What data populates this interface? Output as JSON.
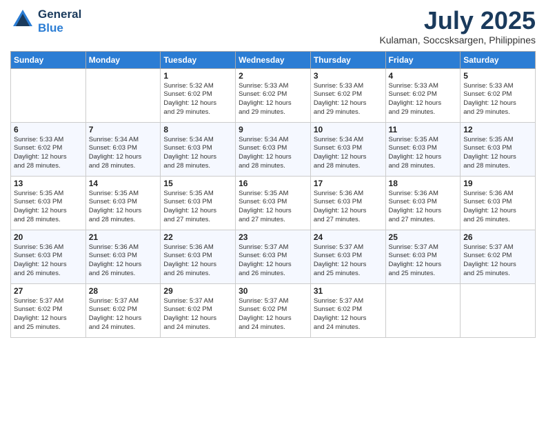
{
  "header": {
    "logo_line1": "General",
    "logo_line2": "Blue",
    "month": "July 2025",
    "location": "Kulaman, Soccsksargen, Philippines"
  },
  "days_of_week": [
    "Sunday",
    "Monday",
    "Tuesday",
    "Wednesday",
    "Thursday",
    "Friday",
    "Saturday"
  ],
  "weeks": [
    [
      {
        "day": "",
        "info": ""
      },
      {
        "day": "",
        "info": ""
      },
      {
        "day": "1",
        "info": "Sunrise: 5:32 AM\nSunset: 6:02 PM\nDaylight: 12 hours\nand 29 minutes."
      },
      {
        "day": "2",
        "info": "Sunrise: 5:33 AM\nSunset: 6:02 PM\nDaylight: 12 hours\nand 29 minutes."
      },
      {
        "day": "3",
        "info": "Sunrise: 5:33 AM\nSunset: 6:02 PM\nDaylight: 12 hours\nand 29 minutes."
      },
      {
        "day": "4",
        "info": "Sunrise: 5:33 AM\nSunset: 6:02 PM\nDaylight: 12 hours\nand 29 minutes."
      },
      {
        "day": "5",
        "info": "Sunrise: 5:33 AM\nSunset: 6:02 PM\nDaylight: 12 hours\nand 29 minutes."
      }
    ],
    [
      {
        "day": "6",
        "info": "Sunrise: 5:33 AM\nSunset: 6:02 PM\nDaylight: 12 hours\nand 28 minutes."
      },
      {
        "day": "7",
        "info": "Sunrise: 5:34 AM\nSunset: 6:03 PM\nDaylight: 12 hours\nand 28 minutes."
      },
      {
        "day": "8",
        "info": "Sunrise: 5:34 AM\nSunset: 6:03 PM\nDaylight: 12 hours\nand 28 minutes."
      },
      {
        "day": "9",
        "info": "Sunrise: 5:34 AM\nSunset: 6:03 PM\nDaylight: 12 hours\nand 28 minutes."
      },
      {
        "day": "10",
        "info": "Sunrise: 5:34 AM\nSunset: 6:03 PM\nDaylight: 12 hours\nand 28 minutes."
      },
      {
        "day": "11",
        "info": "Sunrise: 5:35 AM\nSunset: 6:03 PM\nDaylight: 12 hours\nand 28 minutes."
      },
      {
        "day": "12",
        "info": "Sunrise: 5:35 AM\nSunset: 6:03 PM\nDaylight: 12 hours\nand 28 minutes."
      }
    ],
    [
      {
        "day": "13",
        "info": "Sunrise: 5:35 AM\nSunset: 6:03 PM\nDaylight: 12 hours\nand 28 minutes."
      },
      {
        "day": "14",
        "info": "Sunrise: 5:35 AM\nSunset: 6:03 PM\nDaylight: 12 hours\nand 28 minutes."
      },
      {
        "day": "15",
        "info": "Sunrise: 5:35 AM\nSunset: 6:03 PM\nDaylight: 12 hours\nand 27 minutes."
      },
      {
        "day": "16",
        "info": "Sunrise: 5:35 AM\nSunset: 6:03 PM\nDaylight: 12 hours\nand 27 minutes."
      },
      {
        "day": "17",
        "info": "Sunrise: 5:36 AM\nSunset: 6:03 PM\nDaylight: 12 hours\nand 27 minutes."
      },
      {
        "day": "18",
        "info": "Sunrise: 5:36 AM\nSunset: 6:03 PM\nDaylight: 12 hours\nand 27 minutes."
      },
      {
        "day": "19",
        "info": "Sunrise: 5:36 AM\nSunset: 6:03 PM\nDaylight: 12 hours\nand 26 minutes."
      }
    ],
    [
      {
        "day": "20",
        "info": "Sunrise: 5:36 AM\nSunset: 6:03 PM\nDaylight: 12 hours\nand 26 minutes."
      },
      {
        "day": "21",
        "info": "Sunrise: 5:36 AM\nSunset: 6:03 PM\nDaylight: 12 hours\nand 26 minutes."
      },
      {
        "day": "22",
        "info": "Sunrise: 5:36 AM\nSunset: 6:03 PM\nDaylight: 12 hours\nand 26 minutes."
      },
      {
        "day": "23",
        "info": "Sunrise: 5:37 AM\nSunset: 6:03 PM\nDaylight: 12 hours\nand 26 minutes."
      },
      {
        "day": "24",
        "info": "Sunrise: 5:37 AM\nSunset: 6:03 PM\nDaylight: 12 hours\nand 25 minutes."
      },
      {
        "day": "25",
        "info": "Sunrise: 5:37 AM\nSunset: 6:03 PM\nDaylight: 12 hours\nand 25 minutes."
      },
      {
        "day": "26",
        "info": "Sunrise: 5:37 AM\nSunset: 6:02 PM\nDaylight: 12 hours\nand 25 minutes."
      }
    ],
    [
      {
        "day": "27",
        "info": "Sunrise: 5:37 AM\nSunset: 6:02 PM\nDaylight: 12 hours\nand 25 minutes."
      },
      {
        "day": "28",
        "info": "Sunrise: 5:37 AM\nSunset: 6:02 PM\nDaylight: 12 hours\nand 24 minutes."
      },
      {
        "day": "29",
        "info": "Sunrise: 5:37 AM\nSunset: 6:02 PM\nDaylight: 12 hours\nand 24 minutes."
      },
      {
        "day": "30",
        "info": "Sunrise: 5:37 AM\nSunset: 6:02 PM\nDaylight: 12 hours\nand 24 minutes."
      },
      {
        "day": "31",
        "info": "Sunrise: 5:37 AM\nSunset: 6:02 PM\nDaylight: 12 hours\nand 24 minutes."
      },
      {
        "day": "",
        "info": ""
      },
      {
        "day": "",
        "info": ""
      }
    ]
  ]
}
